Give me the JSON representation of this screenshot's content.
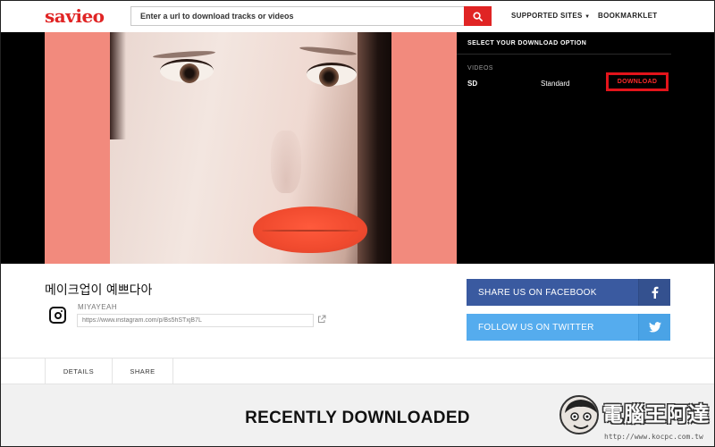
{
  "header": {
    "logo": "savieo",
    "search_placeholder": "Enter a url to download tracks or videos",
    "nav": {
      "supported_sites": "SUPPORTED SITES",
      "bookmarklet": "BOOKMARKLET"
    }
  },
  "download_panel": {
    "title": "SELECT YOUR DOWNLOAD OPTION",
    "section": "VIDEOS",
    "options": [
      {
        "quality": "SD",
        "label": "Standard",
        "button": "DOWNLOAD"
      }
    ]
  },
  "media": {
    "title": "메이크업이 예쁘다아",
    "username": "MIYAYEAH",
    "url": "https://www.instagram.com/p/Bs5hSTxjB7L"
  },
  "share": {
    "facebook": "SHARE US ON FACEBOOK",
    "twitter": "FOLLOW US ON TWITTER"
  },
  "tabs": [
    {
      "label": "DETAILS"
    },
    {
      "label": "SHARE"
    }
  ],
  "recent": {
    "title": "RECENTLY DOWNLOADED"
  },
  "watermark": {
    "text": "電腦王阿達",
    "url": "http://www.kocpc.com.tw"
  },
  "colors": {
    "brand_red": "#e02424",
    "facebook": "#3a5aa0",
    "twitter": "#55acee"
  }
}
